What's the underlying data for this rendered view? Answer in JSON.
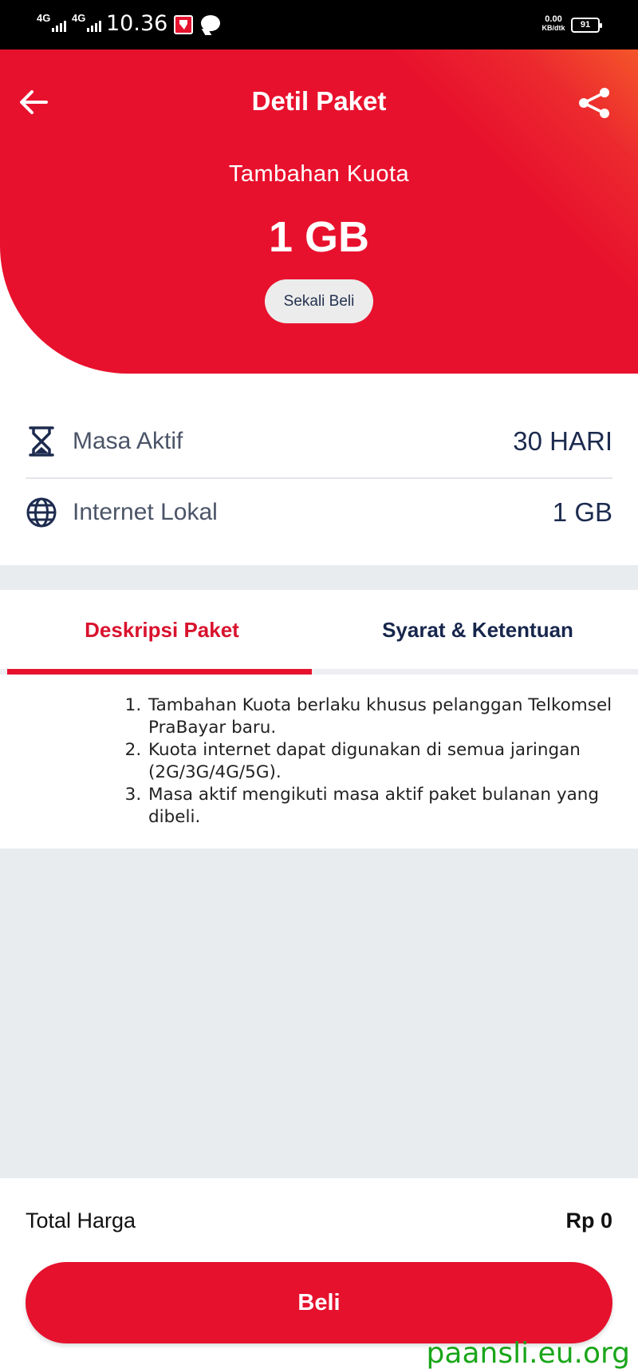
{
  "status_bar": {
    "network1": "4G",
    "network2": "4G",
    "time": "10.36",
    "speed_value": "0.00",
    "speed_unit": "KB/dtk",
    "battery": "91"
  },
  "header": {
    "title": "Detil Paket",
    "subtitle": "Tambahan Kuota",
    "quota": "1 GB",
    "badge": "Sekali Beli",
    "back_icon": "arrow-left-icon",
    "share_icon": "share-icon",
    "colors": {
      "primary_red": "#e8112d",
      "accent_orange": "#f4562a"
    }
  },
  "details": [
    {
      "icon": "hourglass-icon",
      "label": "Masa Aktif",
      "value": "30 HARI"
    },
    {
      "icon": "globe-icon",
      "label": "Internet Lokal",
      "value": "1 GB"
    }
  ],
  "tabs": [
    {
      "label": "Deskripsi Paket",
      "active": true
    },
    {
      "label": "Syarat & Ketentuan",
      "active": false
    }
  ],
  "description": [
    "Tambahan Kuota berlaku khusus pelanggan Telkomsel PraBayar baru.",
    "Kuota internet dapat digunakan di semua jaringan (2G/3G/4G/5G).",
    "Masa aktif mengikuti masa aktif paket bulanan yang dibeli."
  ],
  "footer": {
    "total_label": "Total Harga",
    "total_value": "Rp 0",
    "buy_label": "Beli"
  },
  "watermark": "paansli.eu.org"
}
